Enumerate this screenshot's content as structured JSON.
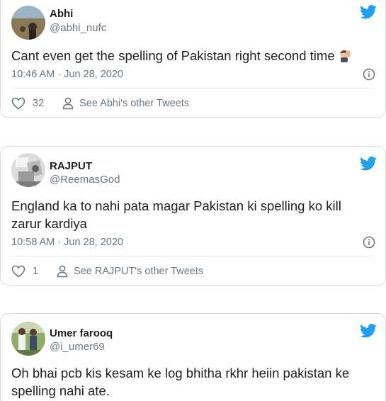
{
  "tweets": [
    {
      "name": "Abhi",
      "handle": "@abhi_nufc",
      "text": "Cant even get the spelling of Pakistan right second time",
      "emoji": "face-palm-emoji",
      "timestamp": "10:46 AM · Jun 28, 2020",
      "likes": "32",
      "see_other": "See Abhi's other Tweets"
    },
    {
      "name": "RAJPUT",
      "handle": "@ReemasGod",
      "text": "England ka to nahi pata magar Pakistan ki spelling ko kill zarur kardiya",
      "timestamp": "10:58 AM · Jun 28, 2020",
      "likes": "1",
      "see_other": "See RAJPUT's other Tweets"
    },
    {
      "name": "Umer farooq",
      "handle": "@i_umer69",
      "text": "Oh bhai pcb kis kesam ke log bhitha rkhr heiin pakistan ke spelling nahi ate."
    }
  ],
  "colors": {
    "twitter_blue": "#1da1f2",
    "secondary_text": "#697882",
    "primary_text": "#1c2022",
    "border": "#d9dde1"
  },
  "icons": [
    "twitter-bird-icon",
    "info-icon",
    "heart-icon",
    "person-icon"
  ]
}
